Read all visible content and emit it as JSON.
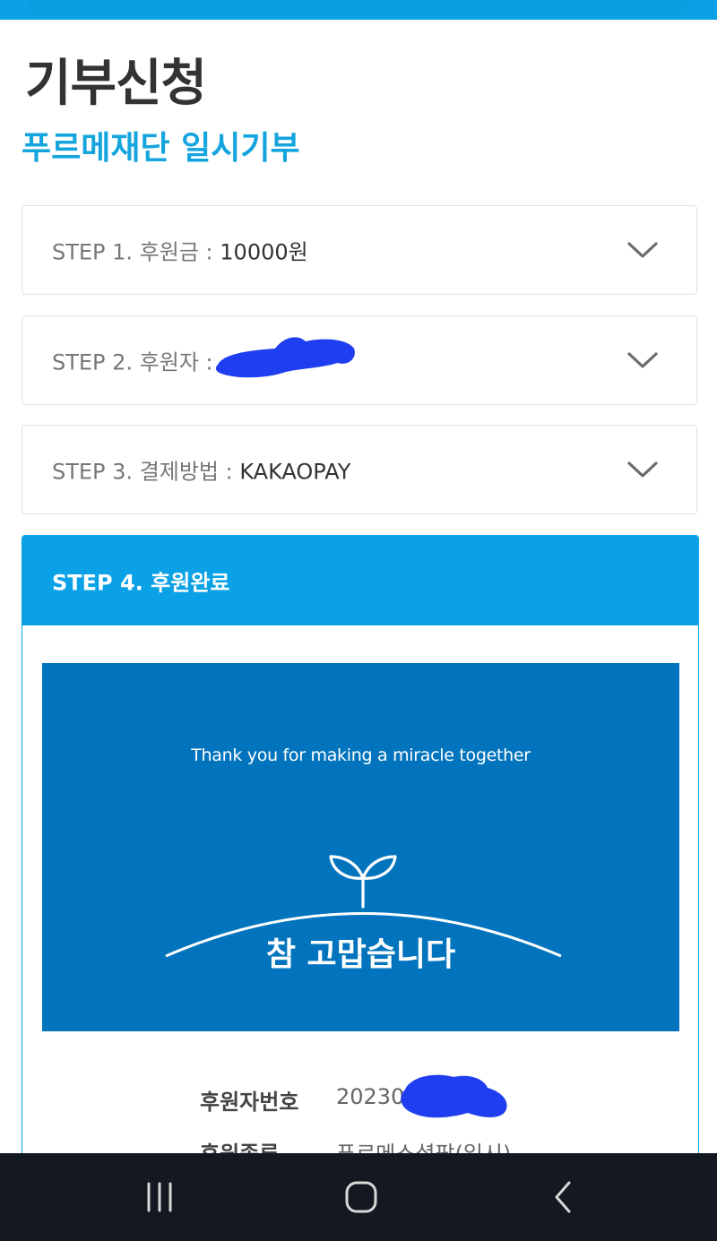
{
  "page": {
    "title": "기부신청",
    "subtitle": "푸르메재단 일시기부"
  },
  "steps": [
    {
      "label": "STEP 1. 후원금 : ",
      "value": "10000원"
    },
    {
      "label": "STEP 2. 후원자 : ",
      "value": ""
    },
    {
      "label": "STEP 3. 결제방법 : ",
      "value": "KAKAOPAY"
    }
  ],
  "step4": {
    "title": "STEP 4. 후원완료",
    "banner": {
      "english_text": "Thank you for making a miracle together",
      "korean_text": "참 고맙습니다"
    },
    "info": [
      {
        "key": "후원자번호",
        "value": "20230"
      },
      {
        "key": "후원종류",
        "value": "푸르메소셜팜(일시)"
      }
    ]
  },
  "colors": {
    "accent": "#0aa1e6",
    "banner": "#0274bd",
    "subtitle": "#14a4de",
    "redaction": "#1f3ef0",
    "navbar": "#141821"
  },
  "icons": {
    "step_toggle": "chevron-down-icon",
    "nav_recent": "recent-apps-icon",
    "nav_home": "home-icon",
    "nav_back": "back-icon"
  }
}
